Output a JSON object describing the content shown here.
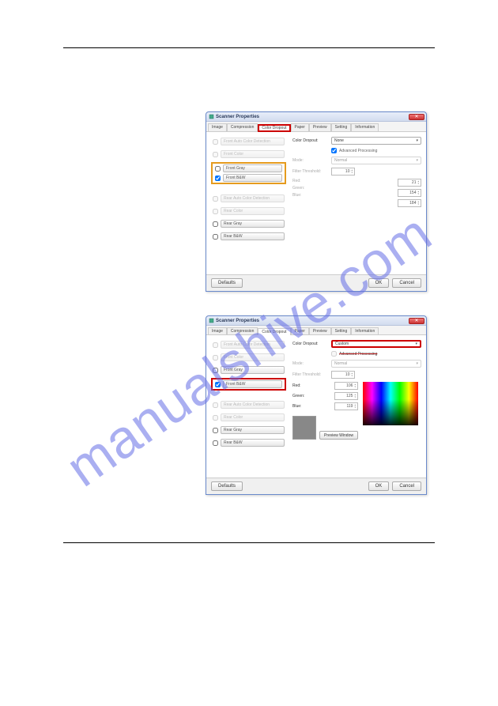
{
  "watermark": "manualshive.com",
  "dialog_title": "Scanner Properties",
  "tabs": {
    "image": "Image",
    "compression": "Compression",
    "color_dropout": "Color Dropout",
    "paper": "Paper",
    "preview": "Preview",
    "setting": "Setting",
    "information": "Information"
  },
  "selections": {
    "front_auto": "Front Auto Color Detection",
    "front_color": "Front Color",
    "front_gray": "Front Gray",
    "front_bw": "Front B&W",
    "rear_auto": "Rear Auto Color Detection",
    "rear_color": "Rear Color",
    "rear_gray": "Rear Gray",
    "rear_bw": "Rear B&W"
  },
  "labels": {
    "color_dropout": "Color Dropout:",
    "advanced_processing": "Advanced Processing",
    "mode": "Mode:",
    "filter_threshold": "Filter Threshold:",
    "red": "Red:",
    "green": "Green:",
    "blue": "Blue:",
    "preview_window": "Preview Window"
  },
  "d1": {
    "color_dropout_value": "None",
    "mode_value": "Normal",
    "filter_threshold_value": "10",
    "red": "21",
    "green": "154",
    "blue": "184"
  },
  "d2": {
    "color_dropout_value": "Custom",
    "mode_value": "Normal",
    "filter_threshold_value": "10",
    "red": "106",
    "green": "125",
    "blue": "119"
  },
  "buttons": {
    "defaults": "Defaults",
    "ok": "OK",
    "cancel": "Cancel"
  }
}
